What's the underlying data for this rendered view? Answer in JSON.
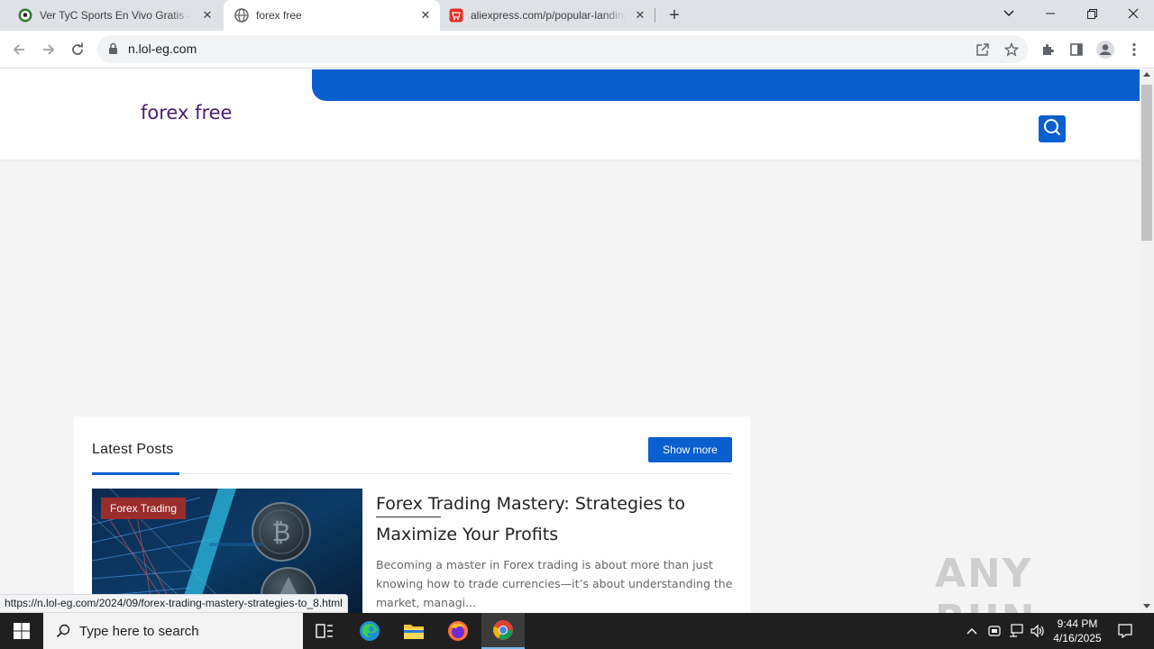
{
  "browser": {
    "tabs": [
      {
        "title": "Ver TyC Sports En Vivo Gratis - Fú",
        "icon": "soccer-ball-icon"
      },
      {
        "title": "forex free",
        "icon": "globe-icon"
      },
      {
        "title": "aliexpress.com/p/popular-landing",
        "icon": "aliexpress-cart-icon"
      }
    ],
    "url": "n.lol-eg.com",
    "status_url": "https://n.lol-eg.com/2024/09/forex-trading-mastery-strategies-to_8.html"
  },
  "site": {
    "logo": "forex free",
    "accent_color": "#0a5fcf"
  },
  "latest_posts": {
    "heading": "Latest Posts",
    "show_more": "Show more",
    "post": {
      "category": "Forex Trading",
      "title": "Forex Trading Mastery: Strategies to Maximize Your Profits",
      "excerpt": "Becoming a master in Forex trading is about more than just knowing how to trade currencies—it’s about understanding the market, managi..."
    }
  },
  "watermark": "ANY RUN",
  "taskbar": {
    "search_placeholder": "Type here to search",
    "time": "9:44 PM",
    "date": "4/16/2025"
  }
}
